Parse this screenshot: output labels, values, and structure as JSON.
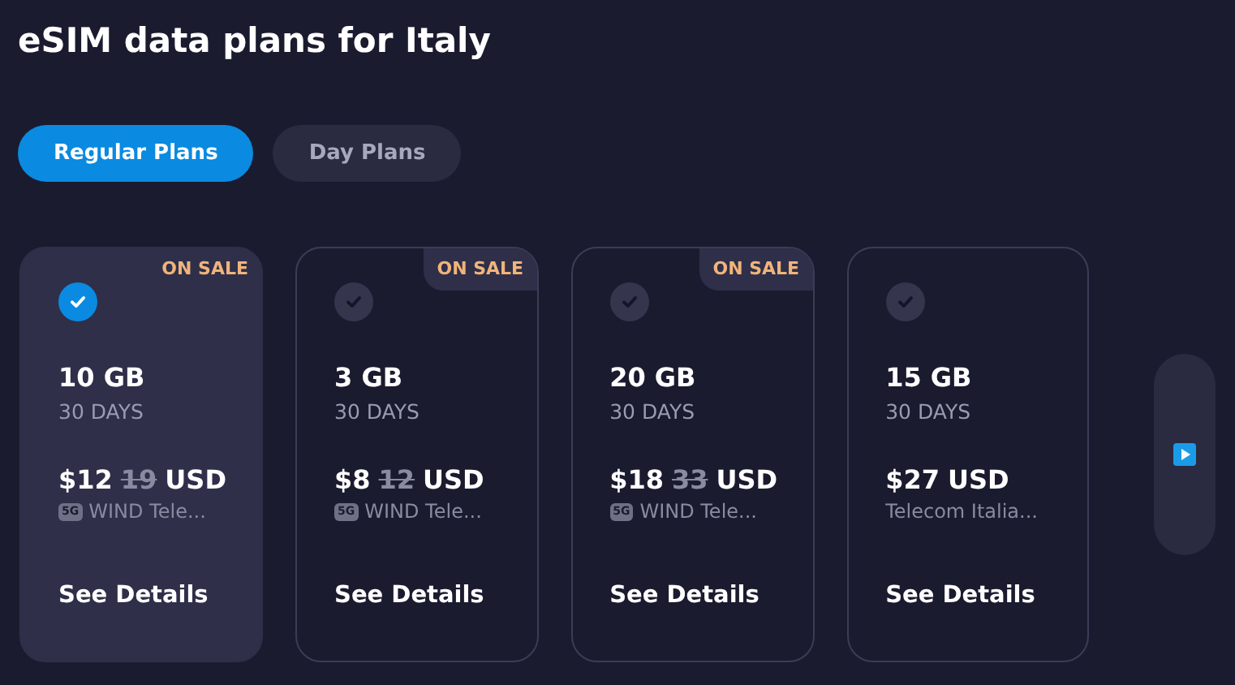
{
  "title": "eSIM data plans for Italy",
  "tabs": [
    {
      "label": "Regular Plans",
      "selected": true
    },
    {
      "label": "Day Plans",
      "selected": false
    }
  ],
  "plans": [
    {
      "data": "10 GB",
      "duration": "30 DAYS",
      "price": "$12",
      "old_price": "19",
      "currency": "USD",
      "network": "5G",
      "operator": "WIND Tele...",
      "details": "See Details",
      "badge": "ON SALE",
      "selected": true
    },
    {
      "data": "3 GB",
      "duration": "30 DAYS",
      "price": "$8",
      "old_price": "12",
      "currency": "USD",
      "network": "5G",
      "operator": "WIND Tele...",
      "details": "See Details",
      "badge": "ON SALE",
      "selected": false
    },
    {
      "data": "20 GB",
      "duration": "30 DAYS",
      "price": "$18",
      "old_price": "33",
      "currency": "USD",
      "network": "5G",
      "operator": "WIND Tele...",
      "details": "See Details",
      "badge": "ON SALE",
      "selected": false
    },
    {
      "data": "15 GB",
      "duration": "30 DAYS",
      "price": "$27",
      "currency": "USD",
      "operator": "Telecom Italia...",
      "details": "See Details",
      "selected": false
    }
  ]
}
